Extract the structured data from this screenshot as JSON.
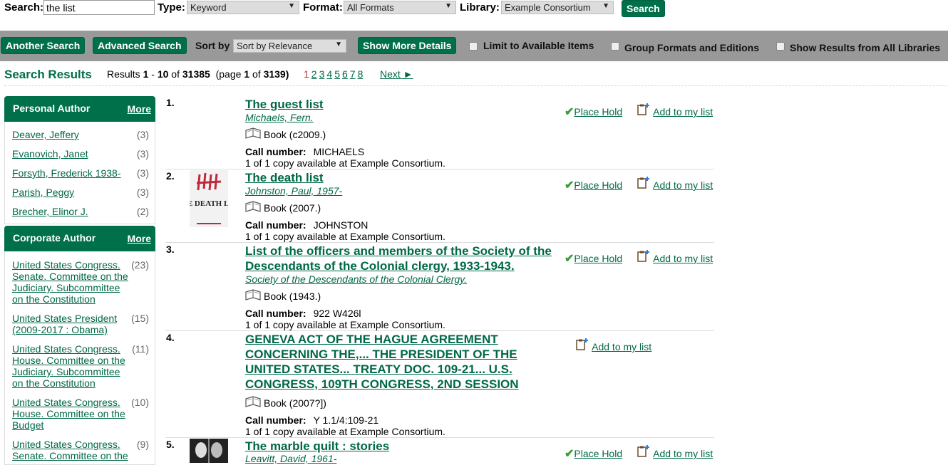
{
  "search": {
    "search_label": "Search:",
    "query_value": "the list",
    "type_label": "Type:",
    "type_value": "Keyword",
    "format_label": "Format:",
    "format_value": "All Formats",
    "library_label": "Library:",
    "library_value": "Example Consortium",
    "search_button": "Search"
  },
  "toolbar": {
    "another_search": "Another Search",
    "advanced_search": "Advanced Search",
    "sort_label": "Sort by",
    "sort_value": "Sort by Relevance",
    "show_more_details": "Show More Details",
    "limit_available": "Limit to Available Items",
    "group_formats": "Group Formats and Editions",
    "show_all_libraries": "Show Results from All Libraries"
  },
  "results_header": {
    "title": "Search Results",
    "results_word": "Results",
    "range_start": "1",
    "range_end": "10",
    "of_word": "of",
    "total": "31385",
    "page_text": "(page",
    "page_num": "1",
    "page_of": "of",
    "page_total": "3139)",
    "pages": [
      "1",
      "2",
      "3",
      "4",
      "5",
      "6",
      "7",
      "8"
    ],
    "next": "Next ►"
  },
  "facets": {
    "personal_author": {
      "title": "Personal Author",
      "more": "More",
      "items": [
        {
          "name": "Deaver, Jeffery",
          "count": "(3)"
        },
        {
          "name": "Evanovich, Janet",
          "count": "(3)"
        },
        {
          "name": "Forsyth, Frederick 1938-",
          "count": "(3)"
        },
        {
          "name": "Parish, Peggy",
          "count": "(3)"
        },
        {
          "name": "Brecher, Elinor J.",
          "count": "(2)"
        }
      ]
    },
    "corporate_author": {
      "title": "Corporate Author",
      "more": "More",
      "items": [
        {
          "name": "United States Congress. Senate. Committee on the Judiciary. Subcommittee on the Constitution",
          "count": "(23)"
        },
        {
          "name": "United States President (2009-2017 : Obama)",
          "count": "(15)"
        },
        {
          "name": "United States Congress. House. Committee on the Judiciary. Subcommittee on the Constitution",
          "count": "(11)"
        },
        {
          "name": "United States Congress. House. Committee on the Budget",
          "count": "(10)"
        },
        {
          "name": "United States Congress. Senate. Committee on the",
          "count": "(9)"
        }
      ]
    }
  },
  "results": [
    {
      "num": "1.",
      "title": "The guest list",
      "author": "Michaels, Fern.",
      "format": "Book (c2009.)",
      "call_label": "Call number:",
      "call_number": "MICHAELS",
      "availability": "1 of 1 copy available at Example Consortium.",
      "place_hold": "Place Hold",
      "add_to_list": "Add to my list"
    },
    {
      "num": "2.",
      "title": "The death list",
      "author": "Johnston, Paul, 1957-",
      "format": "Book (2007.)",
      "call_label": "Call number:",
      "call_number": "JOHNSTON",
      "availability": "1 of 1 copy available at Example Consortium.",
      "place_hold": "Place Hold",
      "add_to_list": "Add to my list",
      "cover_text": "THE DEATH LIST"
    },
    {
      "num": "3.",
      "title": "List of the officers and members of the Society of the Descendants of the Colonial clergy, 1933-1943.",
      "author": "Society of the Descendants of the Colonial Clergy.",
      "format": "Book (1943.)",
      "call_label": "Call number:",
      "call_number": "922 W426l",
      "availability": "1 of 1 copy available at Example Consortium.",
      "place_hold": "Place Hold",
      "add_to_list": "Add to my list"
    },
    {
      "num": "4.",
      "title": "GENEVA ACT OF THE HAGUE AGREEMENT CONCERNING THE,... THE PRESIDENT OF THE UNITED STATES... TREATY DOC. 109-21... U.S. CONGRESS, 109TH CONGRESS, 2ND SESSION",
      "author": "",
      "format": "Book (2007?])",
      "call_label": "Call number:",
      "call_number": "Y 1.1/4:109-21",
      "availability": "1 of 1 copy available at Example Consortium.",
      "add_to_list": "Add to my list"
    },
    {
      "num": "5.",
      "title": "The marble quilt : stories",
      "author": "Leavitt, David, 1961-",
      "place_hold": "Place Hold",
      "add_to_list": "Add to my list"
    }
  ]
}
